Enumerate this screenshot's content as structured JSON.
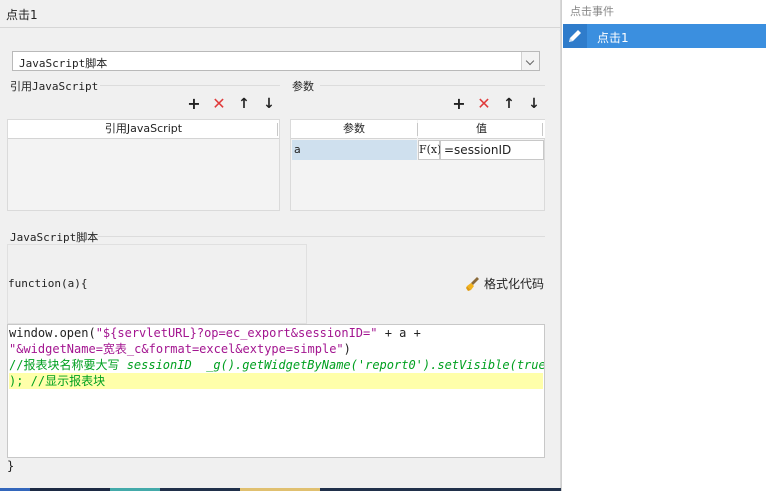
{
  "window": {
    "title": "点击1"
  },
  "script_type_select": {
    "value": "JavaScript脚本"
  },
  "ref_js": {
    "section_label": "引用JavaScript",
    "column_header": "引用JavaScript"
  },
  "params": {
    "section_label": "参数",
    "columns": [
      "参数",
      "值"
    ],
    "rows": [
      {
        "name": "a",
        "fx": "F(x)",
        "value": "=sessionID"
      }
    ]
  },
  "script": {
    "section_label": "JavaScript脚本",
    "fn_open": "function(a){",
    "fn_close": "}",
    "format_button": "格式化代码",
    "lines": [
      {
        "parts": [
          {
            "t": "window.open(",
            "c": ""
          },
          {
            "t": "\"${servletURL}?op=ec_export&sessionID=\"",
            "c": "str"
          },
          {
            "t": " + a +",
            "c": ""
          }
        ]
      },
      {
        "parts": [
          {
            "t": "\"&widgetName=宽表_c&format=excel&extype=simple\"",
            "c": "str"
          },
          {
            "t": ")",
            "c": ""
          }
        ]
      },
      {
        "parts": [
          {
            "t": "//报表块名称要大写 ",
            "c": "cmt"
          },
          {
            "t": "sessionID  _g().getWidgetByName('report0').setVisible(true",
            "c": "cmt-i"
          }
        ]
      },
      {
        "parts": [
          {
            "t": "); //显示报表块",
            "c": "cmt"
          }
        ]
      }
    ]
  },
  "events_panel": {
    "header": "点击事件",
    "items": [
      {
        "label": "点击1",
        "selected": true
      }
    ]
  },
  "icons": {
    "add": "plus-icon",
    "delete": "cross-icon",
    "up": "arrow-up-icon",
    "down": "arrow-down-icon",
    "broom": "broom-icon",
    "pencil": "pencil-icon",
    "dropdown": "chevron-down-icon"
  }
}
